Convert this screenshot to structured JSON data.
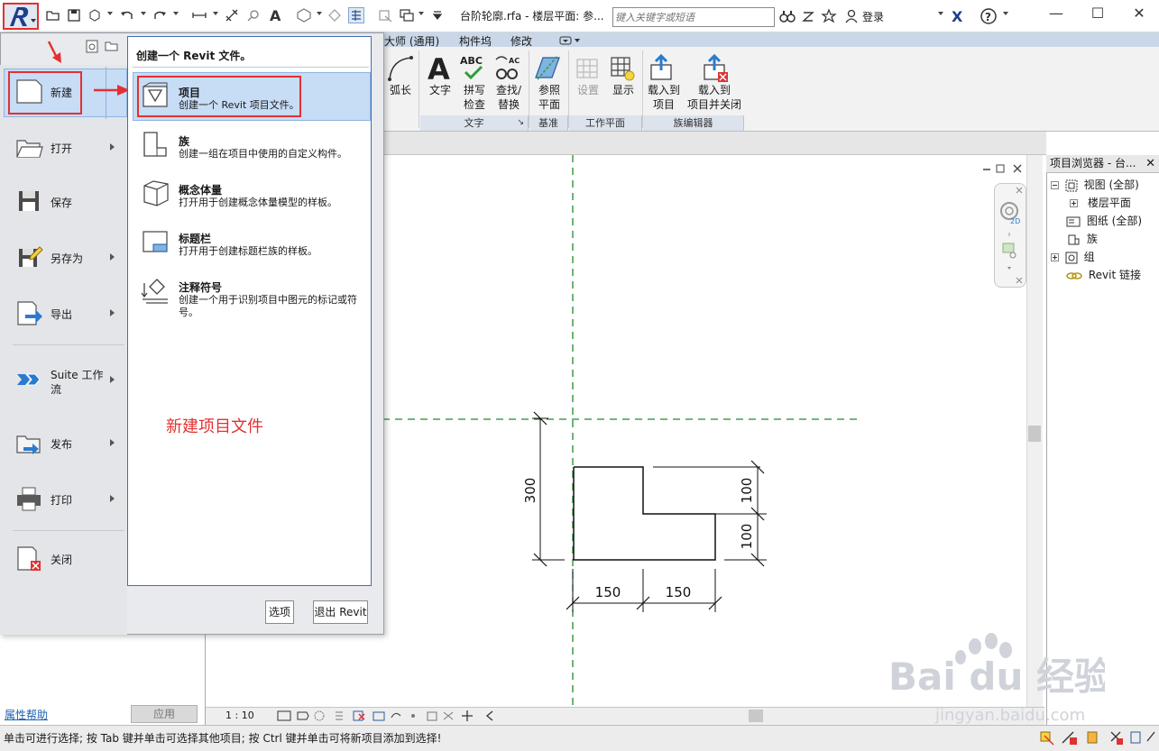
{
  "titlebar": {
    "title": "台阶轮廓.rfa - 楼层平面: 参...",
    "search_placeholder": "键入关键字或短语",
    "login": "登录"
  },
  "ribbon": {
    "tabs": [
      "大师 (通用)",
      "构件坞",
      "修改"
    ],
    "buttons": [
      {
        "label": "弧长"
      },
      {
        "label": "文字"
      },
      {
        "label": "拼写\n检查"
      },
      {
        "label": "查找/\n替换"
      },
      {
        "label": "参照\n平面"
      },
      {
        "label": "设置"
      },
      {
        "label": "显示"
      },
      {
        "label": "载入到\n项目"
      },
      {
        "label": "载入到\n项目并关闭"
      }
    ],
    "panels": [
      "文字",
      "基准",
      "工作平面",
      "族编辑器"
    ]
  },
  "app_menu": {
    "items": [
      {
        "label": "新建"
      },
      {
        "label": "打开"
      },
      {
        "label": "保存"
      },
      {
        "label": "另存为"
      },
      {
        "label": "导出"
      },
      {
        "label": "Suite 工作\n流"
      },
      {
        "label": "发布"
      },
      {
        "label": "打印"
      },
      {
        "label": "关闭"
      }
    ],
    "submenu": {
      "header": "创建一个 Revit 文件。",
      "items": [
        {
          "title": "项目",
          "desc": "创建一个 Revit 项目文件。"
        },
        {
          "title": "族",
          "desc": "创建一组在项目中使用的自定义构件。"
        },
        {
          "title": "概念体量",
          "desc": "打开用于创建概念体量模型的样板。"
        },
        {
          "title": "标题栏",
          "desc": "打开用于创建标题栏族的样板。"
        },
        {
          "title": "注释符号",
          "desc": "创建一个用于识别项目中图元的标记或符号。"
        }
      ]
    },
    "options_button": "选项",
    "exit_button": "退出 Revit"
  },
  "annotation": "新建项目文件",
  "project_browser": {
    "title": "项目浏览器 - 台...",
    "items": [
      {
        "label": "视图 (全部)"
      },
      {
        "label": "楼层平面"
      },
      {
        "label": "图纸 (全部)"
      },
      {
        "label": "族"
      },
      {
        "label": "组"
      },
      {
        "label": "Revit 链接"
      }
    ]
  },
  "properties": {
    "help_link": "属性帮助",
    "apply_button": "应用"
  },
  "view_control": {
    "scale": "1 : 10"
  },
  "navbar": {
    "label_2d": "2D"
  },
  "drawing": {
    "dimensions": [
      "300",
      "100",
      "100",
      "150",
      "150"
    ]
  },
  "status": {
    "text": "单击可进行选择; 按 Tab 键并单击可选择其他项目; 按 Ctrl 键并单击可将新项目添加到选择!"
  },
  "watermark": {
    "brand": "Bai du 经验",
    "url": "jingyan.baidu.com"
  },
  "colors": {
    "highlight": "#c7dcf5",
    "annotation_red": "#e53030",
    "ribbon_tab_bg": "#c9d7e8",
    "ref_line_green": "#1f8a2b"
  }
}
